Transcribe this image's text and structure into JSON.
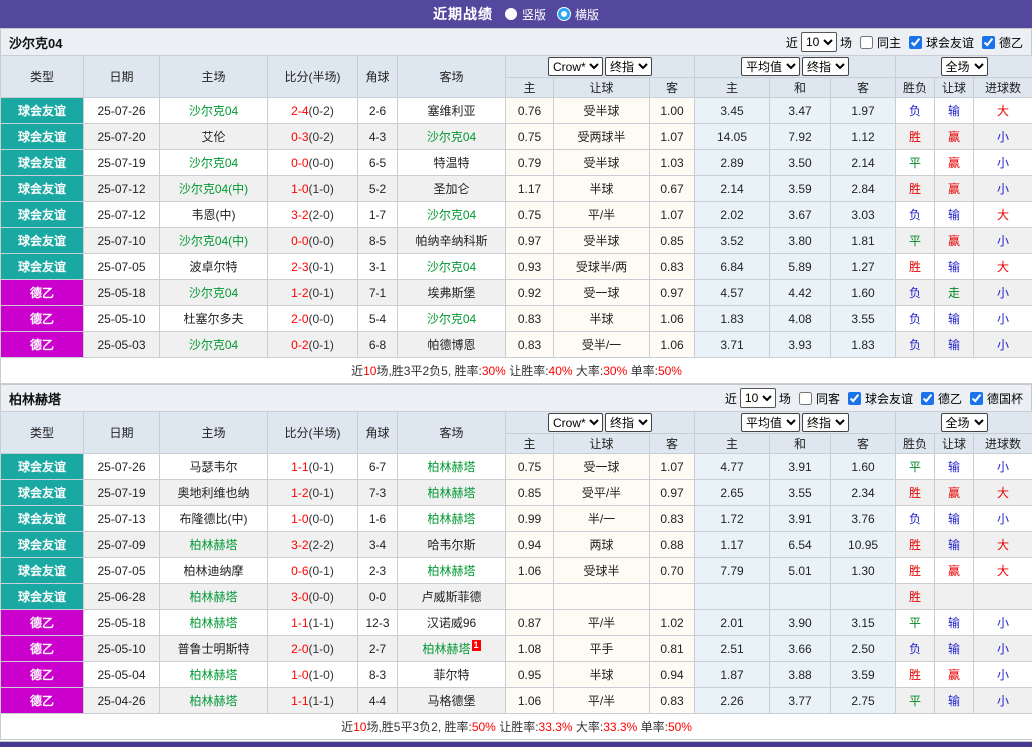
{
  "topbar": {
    "title": "近期战绩",
    "vertical_label": "竖版",
    "horizontal_label": "横版"
  },
  "colors": {
    "topbar_bg": "#54489E",
    "footer_bg": "#443A8F",
    "highlight_team": "#009933",
    "score_red": "#FF0000",
    "crow_col_bg": "#FEFAF4",
    "avg_col_bg": "#E9F3F7",
    "league_colors": {
      "球会友谊": "#19A8A2",
      "德乙": "#CC00CC"
    },
    "result_colors": {
      "胜": "#E60000",
      "赢": "#E60000",
      "大": "#E60000",
      "平": "#008822",
      "走": "#008822",
      "负": "#2222CC",
      "输": "#2222CC",
      "小": "#2222CC"
    }
  },
  "header_labels": {
    "type": "类型",
    "date": "日期",
    "home": "主场",
    "score": "比分(半场)",
    "corner": "角球",
    "away": "客场",
    "crow_select": "Crow*",
    "crow_final_select": "终指",
    "crow_cols": [
      "主",
      "让球",
      "客"
    ],
    "avg_select": "平均值",
    "avg_final_select": "终指",
    "avg_cols": [
      "主",
      "和",
      "客"
    ],
    "scope_select": "全场",
    "result_cols": [
      "胜负",
      "让球",
      "进球数"
    ]
  },
  "tables": [
    {
      "team": "沙尔克04",
      "controls": {
        "near_label": "近",
        "match_count": "10",
        "games_label": "场",
        "same_label": "同主",
        "same_checked": false,
        "leagues": [
          {
            "label": "球会友谊",
            "checked": true
          },
          {
            "label": "德乙",
            "checked": true
          }
        ]
      },
      "rows": [
        {
          "type": "球会友谊",
          "date": "25-07-26",
          "home": "沙尔克04",
          "home_hl": true,
          "score": "2-4",
          "half": "(0-2)",
          "corner": "2-6",
          "away": "塞维利亚",
          "away_hl": false,
          "o1": "0.76",
          "hcap": "受半球",
          "o2": "1.00",
          "a1": "3.45",
          "a2": "3.47",
          "a3": "1.97",
          "r1": "负",
          "r2": "输",
          "r3": "大"
        },
        {
          "type": "球会友谊",
          "date": "25-07-20",
          "home": "艾伦",
          "home_hl": false,
          "score": "0-3",
          "half": "(0-2)",
          "corner": "4-3",
          "away": "沙尔克04",
          "away_hl": true,
          "o1": "0.75",
          "hcap": "受两球半",
          "o2": "1.07",
          "a1": "14.05",
          "a2": "7.92",
          "a3": "1.12",
          "r1": "胜",
          "r2": "赢",
          "r3": "小"
        },
        {
          "type": "球会友谊",
          "date": "25-07-19",
          "home": "沙尔克04",
          "home_hl": true,
          "score": "0-0",
          "half": "(0-0)",
          "corner": "6-5",
          "away": "特温特",
          "away_hl": false,
          "o1": "0.79",
          "hcap": "受半球",
          "o2": "1.03",
          "a1": "2.89",
          "a2": "3.50",
          "a3": "2.14",
          "r1": "平",
          "r2": "赢",
          "r3": "小"
        },
        {
          "type": "球会友谊",
          "date": "25-07-12",
          "home": "沙尔克04(中)",
          "home_hl": true,
          "score": "1-0",
          "half": "(1-0)",
          "corner": "5-2",
          "away": "圣加仑",
          "away_hl": false,
          "o1": "1.17",
          "hcap": "半球",
          "o2": "0.67",
          "a1": "2.14",
          "a2": "3.59",
          "a3": "2.84",
          "r1": "胜",
          "r2": "赢",
          "r3": "小"
        },
        {
          "type": "球会友谊",
          "date": "25-07-12",
          "home": "韦恩(中)",
          "home_hl": false,
          "score": "3-2",
          "half": "(2-0)",
          "corner": "1-7",
          "away": "沙尔克04",
          "away_hl": true,
          "o1": "0.75",
          "hcap": "平/半",
          "o2": "1.07",
          "a1": "2.02",
          "a2": "3.67",
          "a3": "3.03",
          "r1": "负",
          "r2": "输",
          "r3": "大"
        },
        {
          "type": "球会友谊",
          "date": "25-07-10",
          "home": "沙尔克04(中)",
          "home_hl": true,
          "score": "0-0",
          "half": "(0-0)",
          "corner": "8-5",
          "away": "帕纳辛纳科斯",
          "away_hl": false,
          "o1": "0.97",
          "hcap": "受半球",
          "o2": "0.85",
          "a1": "3.52",
          "a2": "3.80",
          "a3": "1.81",
          "r1": "平",
          "r2": "赢",
          "r3": "小"
        },
        {
          "type": "球会友谊",
          "date": "25-07-05",
          "home": "波卓尔特",
          "home_hl": false,
          "score": "2-3",
          "half": "(0-1)",
          "corner": "3-1",
          "away": "沙尔克04",
          "away_hl": true,
          "o1": "0.93",
          "hcap": "受球半/两",
          "o2": "0.83",
          "a1": "6.84",
          "a2": "5.89",
          "a3": "1.27",
          "r1": "胜",
          "r2": "输",
          "r3": "大"
        },
        {
          "type": "德乙",
          "date": "25-05-18",
          "home": "沙尔克04",
          "home_hl": true,
          "score": "1-2",
          "half": "(0-1)",
          "corner": "7-1",
          "away": "埃弗斯堡",
          "away_hl": false,
          "o1": "0.92",
          "hcap": "受一球",
          "o2": "0.97",
          "a1": "4.57",
          "a2": "4.42",
          "a3": "1.60",
          "r1": "负",
          "r2": "走",
          "r3": "小"
        },
        {
          "type": "德乙",
          "date": "25-05-10",
          "home": "杜塞尔多夫",
          "home_hl": false,
          "score": "2-0",
          "half": "(0-0)",
          "corner": "5-4",
          "away": "沙尔克04",
          "away_hl": true,
          "o1": "0.83",
          "hcap": "半球",
          "o2": "1.06",
          "a1": "1.83",
          "a2": "4.08",
          "a3": "3.55",
          "r1": "负",
          "r2": "输",
          "r3": "小"
        },
        {
          "type": "德乙",
          "date": "25-05-03",
          "home": "沙尔克04",
          "home_hl": true,
          "score": "0-2",
          "half": "(0-1)",
          "corner": "6-8",
          "away": "帕德博恩",
          "away_hl": false,
          "o1": "0.83",
          "hcap": "受半/一",
          "o2": "1.06",
          "a1": "3.71",
          "a2": "3.93",
          "a3": "1.83",
          "r1": "负",
          "r2": "输",
          "r3": "小"
        }
      ],
      "summary": [
        {
          "text": "近",
          "red": false
        },
        {
          "text": "10",
          "red": true
        },
        {
          "text": "场,胜3平2负5, 胜率:",
          "red": false
        },
        {
          "text": "30%",
          "red": true
        },
        {
          "text": " 让胜率:",
          "red": false
        },
        {
          "text": "40%",
          "red": true
        },
        {
          "text": " 大率:",
          "red": false
        },
        {
          "text": "30%",
          "red": true
        },
        {
          "text": " 单率:",
          "red": false
        },
        {
          "text": "50%",
          "red": true
        }
      ]
    },
    {
      "team": "柏林赫塔",
      "controls": {
        "near_label": "近",
        "match_count": "10",
        "games_label": "场",
        "same_label": "同客",
        "same_checked": false,
        "leagues": [
          {
            "label": "球会友谊",
            "checked": true
          },
          {
            "label": "德乙",
            "checked": true
          },
          {
            "label": "德国杯",
            "checked": true
          }
        ]
      },
      "rows": [
        {
          "type": "球会友谊",
          "date": "25-07-26",
          "home": "马瑟韦尔",
          "home_hl": false,
          "score": "1-1",
          "half": "(0-1)",
          "corner": "6-7",
          "away": "柏林赫塔",
          "away_hl": true,
          "o1": "0.75",
          "hcap": "受一球",
          "o2": "1.07",
          "a1": "4.77",
          "a2": "3.91",
          "a3": "1.60",
          "r1": "平",
          "r2": "输",
          "r3": "小"
        },
        {
          "type": "球会友谊",
          "date": "25-07-19",
          "home": "奥地利维也纳",
          "home_hl": false,
          "score": "1-2",
          "half": "(0-1)",
          "corner": "7-3",
          "away": "柏林赫塔",
          "away_hl": true,
          "o1": "0.85",
          "hcap": "受平/半",
          "o2": "0.97",
          "a1": "2.65",
          "a2": "3.55",
          "a3": "2.34",
          "r1": "胜",
          "r2": "赢",
          "r3": "大"
        },
        {
          "type": "球会友谊",
          "date": "25-07-13",
          "home": "布隆德比(中)",
          "home_hl": false,
          "score": "1-0",
          "half": "(0-0)",
          "corner": "1-6",
          "away": "柏林赫塔",
          "away_hl": true,
          "o1": "0.99",
          "hcap": "半/一",
          "o2": "0.83",
          "a1": "1.72",
          "a2": "3.91",
          "a3": "3.76",
          "r1": "负",
          "r2": "输",
          "r3": "小"
        },
        {
          "type": "球会友谊",
          "date": "25-07-09",
          "home": "柏林赫塔",
          "home_hl": true,
          "score": "3-2",
          "half": "(2-2)",
          "corner": "3-4",
          "away": "哈韦尔斯",
          "away_hl": false,
          "o1": "0.94",
          "hcap": "两球",
          "o2": "0.88",
          "a1": "1.17",
          "a2": "6.54",
          "a3": "10.95",
          "r1": "胜",
          "r2": "输",
          "r3": "大"
        },
        {
          "type": "球会友谊",
          "date": "25-07-05",
          "home": "柏林迪纳摩",
          "home_hl": false,
          "score": "0-6",
          "half": "(0-1)",
          "corner": "2-3",
          "away": "柏林赫塔",
          "away_hl": true,
          "o1": "1.06",
          "hcap": "受球半",
          "o2": "0.70",
          "a1": "7.79",
          "a2": "5.01",
          "a3": "1.30",
          "r1": "胜",
          "r2": "赢",
          "r3": "大"
        },
        {
          "type": "球会友谊",
          "date": "25-06-28",
          "home": "柏林赫塔",
          "home_hl": true,
          "score": "3-0",
          "half": "(0-0)",
          "corner": "0-0",
          "away": "卢威斯菲德",
          "away_hl": false,
          "o1": "",
          "hcap": "",
          "o2": "",
          "a1": "",
          "a2": "",
          "a3": "",
          "r1": "胜",
          "r2": "",
          "r3": ""
        },
        {
          "type": "德乙",
          "date": "25-05-18",
          "home": "柏林赫塔",
          "home_hl": true,
          "score": "1-1",
          "half": "(1-1)",
          "corner": "12-3",
          "away": "汉诺威96",
          "away_hl": false,
          "o1": "0.87",
          "hcap": "平/半",
          "o2": "1.02",
          "a1": "2.01",
          "a2": "3.90",
          "a3": "3.15",
          "r1": "平",
          "r2": "输",
          "r3": "小"
        },
        {
          "type": "德乙",
          "date": "25-05-10",
          "home": "普鲁士明斯特",
          "home_hl": false,
          "score": "2-0",
          "half": "(1-0)",
          "corner": "2-7",
          "away": "柏林赫塔",
          "away_hl": true,
          "away_card": "1",
          "o1": "1.08",
          "hcap": "平手",
          "o2": "0.81",
          "a1": "2.51",
          "a2": "3.66",
          "a3": "2.50",
          "r1": "负",
          "r2": "输",
          "r3": "小"
        },
        {
          "type": "德乙",
          "date": "25-05-04",
          "home": "柏林赫塔",
          "home_hl": true,
          "score": "1-0",
          "half": "(1-0)",
          "corner": "8-3",
          "away": "菲尔特",
          "away_hl": false,
          "o1": "0.95",
          "hcap": "半球",
          "o2": "0.94",
          "a1": "1.87",
          "a2": "3.88",
          "a3": "3.59",
          "r1": "胜",
          "r2": "赢",
          "r3": "小"
        },
        {
          "type": "德乙",
          "date": "25-04-26",
          "home": "柏林赫塔",
          "home_hl": true,
          "score": "1-1",
          "half": "(1-1)",
          "corner": "4-4",
          "away": "马格德堡",
          "away_hl": false,
          "o1": "1.06",
          "hcap": "平/半",
          "o2": "0.83",
          "a1": "2.26",
          "a2": "3.77",
          "a3": "2.75",
          "r1": "平",
          "r2": "输",
          "r3": "小"
        }
      ],
      "summary": [
        {
          "text": "近",
          "red": false
        },
        {
          "text": "10",
          "red": true
        },
        {
          "text": "场,胜5平3负2, 胜率:",
          "red": false
        },
        {
          "text": "50%",
          "red": true
        },
        {
          "text": " 让胜率:",
          "red": false
        },
        {
          "text": "33.3%",
          "red": true
        },
        {
          "text": " 大率:",
          "red": false
        },
        {
          "text": "33.3%",
          "red": true
        },
        {
          "text": " 单率:",
          "red": false
        },
        {
          "text": "50%",
          "red": true
        }
      ]
    }
  ]
}
